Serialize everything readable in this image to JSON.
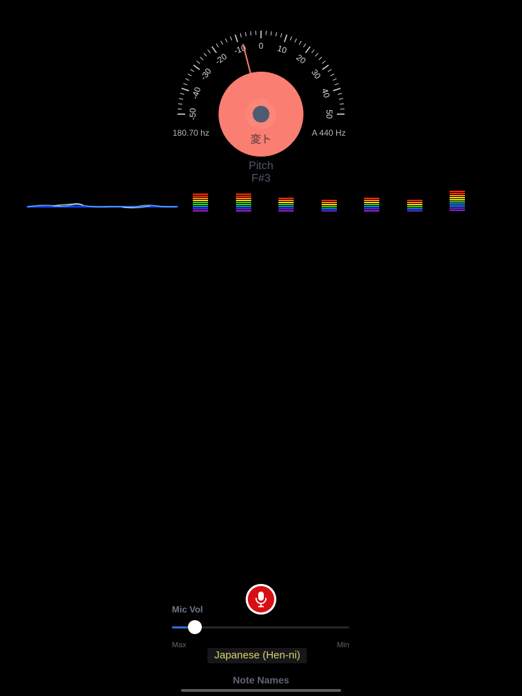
{
  "tuner": {
    "tick_labels": [
      "-50",
      "-40",
      "-30",
      "-20",
      "-10",
      "0",
      "10",
      "20",
      "30",
      "40",
      "50"
    ],
    "needle_cents": -8,
    "frequency_label": "180.70 hz",
    "reference_label": "A 440 Hz",
    "note_label": "変ト",
    "pitch_title": "Pitch",
    "pitch_value": "F#3",
    "disc_color": "#fa7e72",
    "needle_color": "#fa7e72",
    "hub_color": "#4f5a73"
  },
  "spectrum": {
    "bars": [
      {
        "level": 0.78
      },
      {
        "level": 0.78
      },
      {
        "level": 0.62
      },
      {
        "level": 0.54
      },
      {
        "level": 0.62
      },
      {
        "level": 0.54
      },
      {
        "level": 0.92
      }
    ],
    "colors": [
      "#ff2a00",
      "#ff8c00",
      "#ffd800",
      "#2ed12e",
      "#1e7bff",
      "#5a2ce0",
      "#9b1fd6"
    ]
  },
  "controls": {
    "mic_vol_label": "Mic Vol",
    "mic_vol_value": 0.13,
    "min_label": "Min",
    "max_label": "Max",
    "language_value": "Japanese (Hen-ni)",
    "note_names_label": "Note Names",
    "mic_icon": "microphone-icon",
    "accent": "#2f6fde",
    "mic_color": "#d70f14"
  }
}
